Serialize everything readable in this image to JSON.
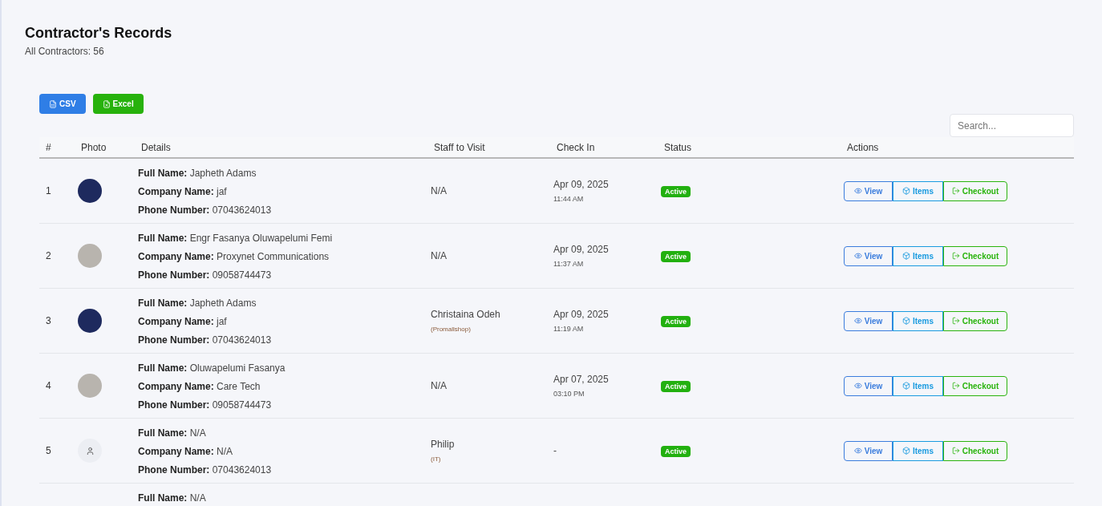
{
  "header": {
    "title": "Contractor's Records",
    "subtitle": "All Contractors: 56"
  },
  "export_buttons": [
    {
      "label": "CSV",
      "kind": "csv"
    },
    {
      "label": "Excel",
      "kind": "excel"
    }
  ],
  "search": {
    "placeholder": "Search..."
  },
  "table": {
    "columns": [
      "#",
      "Photo",
      "Details",
      "Staff to Visit",
      "Check In",
      "Status",
      "Actions"
    ],
    "rows": [
      {
        "index": "1",
        "photo": {
          "kind": "dark"
        },
        "details": [
          {
            "label": "Full Name:",
            "value": "Japheth Adams"
          },
          {
            "label": "Company Name:",
            "value": "jaf"
          },
          {
            "label": "Phone Number:",
            "value": "07043624013"
          }
        ],
        "staff": "N/A",
        "check_in_date": "Apr 09, 2025",
        "check_in_time": "11:44 AM",
        "status": {
          "label": "Active",
          "kind": "active"
        },
        "actions": [
          "View",
          "Items",
          "Checkout"
        ]
      },
      {
        "index": "2",
        "photo": {
          "kind": "light"
        },
        "details": [
          {
            "label": "Full Name:",
            "value": "Engr Fasanya Oluwapelumi Femi"
          },
          {
            "label": "Company Name:",
            "value": "Proxynet Communications"
          },
          {
            "label": "Phone Number:",
            "value": "09058744473"
          }
        ],
        "staff": "N/A",
        "check_in_date": "Apr 09, 2025",
        "check_in_time": "11:37 AM",
        "status": {
          "label": "Active",
          "kind": "active"
        },
        "actions": [
          "View",
          "Items",
          "Checkout"
        ]
      },
      {
        "index": "3",
        "photo": {
          "kind": "dark"
        },
        "details": [
          {
            "label": "Full Name:",
            "value": "Japheth Adams"
          },
          {
            "label": "Company Name:",
            "value": "jaf"
          },
          {
            "label": "Phone Number:",
            "value": "07043624013"
          }
        ],
        "staff": "Christaina Odeh",
        "staff_dept": "(Promallshop)",
        "check_in_date": "Apr 09, 2025",
        "check_in_time": "11:19 AM",
        "status": {
          "label": "Active",
          "kind": "active"
        },
        "actions": [
          "View",
          "Items",
          "Checkout"
        ]
      },
      {
        "index": "4",
        "photo": {
          "kind": "light"
        },
        "details": [
          {
            "label": "Full Name:",
            "value": "Oluwapelumi Fasanya"
          },
          {
            "label": "Company Name:",
            "value": "Care Tech"
          },
          {
            "label": "Phone Number:",
            "value": "09058744473"
          }
        ],
        "staff": "N/A",
        "check_in_date": "Apr 07, 2025",
        "check_in_time": "03:10 PM",
        "status": {
          "label": "Active",
          "kind": "active"
        },
        "actions": [
          "View",
          "Items",
          "Checkout"
        ]
      },
      {
        "index": "5",
        "photo": {
          "kind": "none"
        },
        "details": [
          {
            "label": "Full Name:",
            "value": "N/A"
          },
          {
            "label": "Company Name:",
            "value": "N/A"
          },
          {
            "label": "Phone Number:",
            "value": "07043624013"
          }
        ],
        "staff": "Philip",
        "staff_dept": "(IT)",
        "check_in_date": "-",
        "status": {
          "label": "Active",
          "kind": "active"
        },
        "actions": [
          "View",
          "Items",
          "Checkout"
        ]
      },
      {
        "details": [
          {
            "label": "Full Name:",
            "value": "N/A"
          }
        ]
      }
    ]
  }
}
